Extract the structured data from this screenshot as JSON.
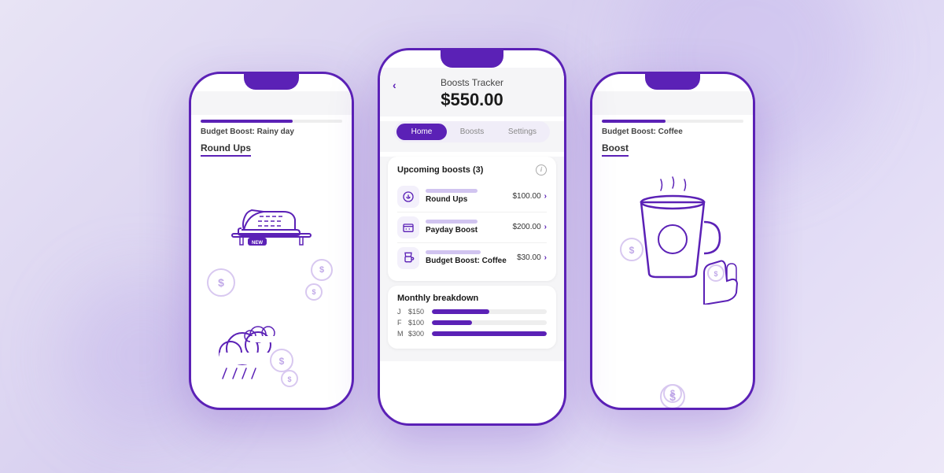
{
  "app": {
    "title": "Boosts Tracker",
    "amount": "$550.00"
  },
  "tabs": [
    {
      "label": "Home",
      "active": true
    },
    {
      "label": "Boosts",
      "active": false
    },
    {
      "label": "Settings",
      "active": false
    }
  ],
  "upcoming_boosts": {
    "title": "Upcoming boosts (3)",
    "items": [
      {
        "name": "Round Ups",
        "amount": "$100.00",
        "icon": "roundups"
      },
      {
        "name": "Payday Boost",
        "amount": "$200.00",
        "icon": "payday"
      },
      {
        "name": "Budget Boost: Coffee",
        "amount": "$30.00",
        "icon": "coffee"
      }
    ]
  },
  "monthly_breakdown": {
    "title": "Monthly breakdown",
    "items": [
      {
        "label": "J",
        "amount": "$150",
        "pct": 50
      },
      {
        "label": "F",
        "amount": "$100",
        "pct": 35
      },
      {
        "label": "M",
        "amount": "$300",
        "pct": 100
      }
    ]
  },
  "left_phone": {
    "section": "Round Ups",
    "prog_label": "Budget Boost: Rainy day"
  },
  "right_phone": {
    "section": "Boost",
    "prog_label": "Budget Boost: Coffee"
  },
  "back_label": "‹"
}
